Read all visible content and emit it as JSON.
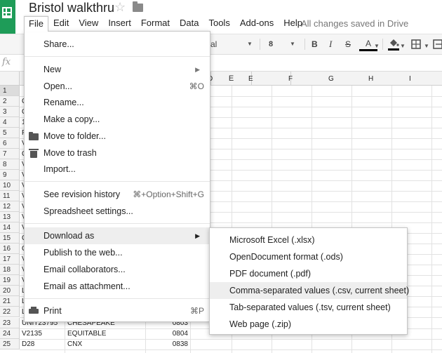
{
  "doc_title": "Bristol walkthru",
  "save_status": "All changes saved in Drive",
  "menubar": [
    "File",
    "Edit",
    "View",
    "Insert",
    "Format",
    "Data",
    "Tools",
    "Add-ons",
    "Help"
  ],
  "toolbar": {
    "font_name": "al",
    "font_size": "8",
    "bold": "B",
    "italic": "I",
    "strike": "S",
    "text_color": "A",
    "text_color_value": "#000000"
  },
  "formula_icon": "fx",
  "columns": [
    "D",
    "E",
    "F",
    "G",
    "H",
    "I"
  ],
  "rows": [
    "1",
    "2",
    "3",
    "4",
    "5",
    "6",
    "7",
    "8",
    "9",
    "10",
    "11",
    "12",
    "13",
    "14",
    "15",
    "16",
    "17",
    "18",
    "19",
    "20",
    "21",
    "22",
    "23",
    "24",
    "25"
  ],
  "visible_rows": {
    "r23": {
      "a": "UNIT23795",
      "b": "CHESAPEAKE",
      "c": "0803"
    },
    "r24": {
      "a": "V2135",
      "b": "EQUITABLE",
      "c": "0804"
    },
    "r25": {
      "a": "D28",
      "b": "CNX",
      "c": "0838"
    }
  },
  "first_col_chars": [
    "",
    "C",
    "C",
    "1",
    "F",
    "V",
    "C",
    "V",
    "V",
    "V",
    "V",
    "V",
    "V",
    "V",
    "C",
    "C",
    "V",
    "V",
    "V",
    "L",
    "L",
    "L"
  ],
  "file_menu": {
    "share": "Share...",
    "new": "New",
    "open": "Open...",
    "open_shortcut": "⌘O",
    "rename": "Rename...",
    "make_copy": "Make a copy...",
    "move_to_folder": "Move to folder...",
    "move_to_trash": "Move to trash",
    "import": "Import...",
    "revision_history": "See revision history",
    "revision_shortcut": "⌘+Option+Shift+G",
    "spreadsheet_settings": "Spreadsheet settings...",
    "download_as": "Download as",
    "publish": "Publish to the web...",
    "email_collaborators": "Email collaborators...",
    "email_attachment": "Email as attachment...",
    "print": "Print",
    "print_shortcut": "⌘P"
  },
  "download_submenu": [
    "Microsoft Excel (.xlsx)",
    "OpenDocument format (.ods)",
    "PDF document (.pdf)",
    "Comma-separated values (.csv, current sheet)",
    "Tab-separated values (.tsv, current sheet)",
    "Web page (.zip)"
  ],
  "colors": {
    "brand_green": "#1e9c58",
    "menu_highlight": "#eeeeee"
  }
}
